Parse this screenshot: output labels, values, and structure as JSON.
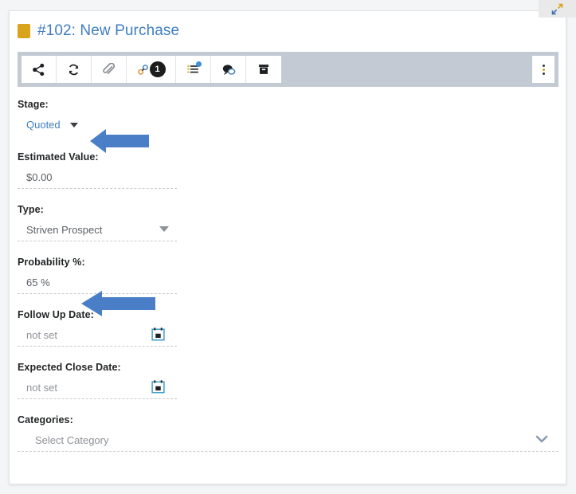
{
  "window": {
    "expand_icon": "expand-diagonal-icon"
  },
  "header": {
    "swatch_color": "#d9a41b",
    "title": "#102: New Purchase",
    "title_color": "#3f7ec0"
  },
  "toolbar": {
    "background": "#c3cad4",
    "buttons": [
      {
        "name": "share-button",
        "icon": "share-icon",
        "label": "Share"
      },
      {
        "name": "refresh-button",
        "icon": "refresh-icon",
        "label": "Refresh"
      },
      {
        "name": "attachments-button",
        "icon": "paperclip-icon",
        "label": "Attachments"
      },
      {
        "name": "links-button",
        "icon": "link-icon",
        "label": "Links",
        "badge": "1"
      },
      {
        "name": "tasks-button",
        "icon": "list-icon",
        "label": "Tasks",
        "has_notification": true
      },
      {
        "name": "comments-button",
        "icon": "chat-bubble-icon",
        "label": "Comments"
      },
      {
        "name": "archive-button",
        "icon": "archive-box-icon",
        "label": "Archive"
      }
    ],
    "overflow_menu": {
      "name": "more-options-button",
      "icon": "kebab-menu-icon",
      "label": "More options"
    }
  },
  "form": {
    "fields": [
      {
        "name": "stage",
        "label": "Stage:",
        "value": "Quoted",
        "control": "dropdown-link"
      },
      {
        "name": "estimated-value",
        "label": "Estimated Value:",
        "value": "$0.00",
        "control": "text"
      },
      {
        "name": "type",
        "label": "Type:",
        "value": "Striven Prospect",
        "control": "select"
      },
      {
        "name": "probability",
        "label": "Probability %:",
        "value": "65 %",
        "control": "text"
      },
      {
        "name": "follow-up-date",
        "label": "Follow Up Date:",
        "value": "not set",
        "control": "date"
      },
      {
        "name": "expected-close-date",
        "label": "Expected Close Date:",
        "value": "not set",
        "control": "date"
      },
      {
        "name": "categories",
        "label": "Categories:",
        "value": "Select Category",
        "control": "multiselect"
      }
    ]
  },
  "annotations": {
    "color": "#4a7ec7",
    "items": [
      {
        "name": "annotation-arrow-stage",
        "points_to": "stage-field-value"
      },
      {
        "name": "annotation-arrow-probability",
        "points_to": "probability-field-value"
      }
    ]
  }
}
